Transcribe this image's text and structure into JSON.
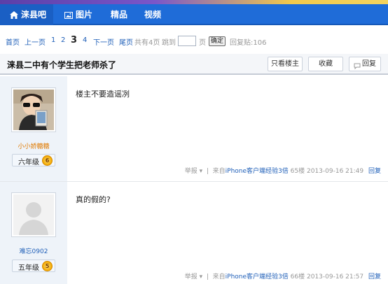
{
  "nav": {
    "items": [
      {
        "label": "涞县吧",
        "icon": "home-icon"
      },
      {
        "label": "图片",
        "icon": "image-icon"
      },
      {
        "label": "精品"
      },
      {
        "label": "视频"
      }
    ],
    "colors": {
      "bar": "#1f6cd8",
      "text": "#ffffff"
    }
  },
  "pager": {
    "first": "首页",
    "prev": "上一页",
    "pages": [
      "1",
      "2",
      "3",
      "4"
    ],
    "current": "3",
    "next": "下一页",
    "last": "尾页",
    "total_prefix": "共有",
    "total_count": "4",
    "total_suffix": "页",
    "jump_label": "跳到",
    "jump_suffix": "页",
    "confirm": "确定",
    "reply_label": "回复贴:",
    "reply_count": "106"
  },
  "thread": {
    "title": "涞县二中有个学生把老师杀了",
    "only_op": "只看楼主",
    "favorite": "收藏",
    "reply": "回复"
  },
  "posts": [
    {
      "username": "小小娇糖糖",
      "level": "六年级",
      "level_num": "6",
      "content": "楼主不要造谣冽",
      "report": "举报",
      "source_prefix": "来自",
      "source": "iPhone客户端",
      "exp": "经验3倍",
      "floor": "65楼",
      "time": "2013-09-16 21:49",
      "reply": "回复"
    },
    {
      "username": "难忘0902",
      "level": "五年级",
      "level_num": "5",
      "content": "真的假的?",
      "report": "举报",
      "source_prefix": "来自",
      "source": "iPhone客户端",
      "exp": "经验3倍",
      "floor": "66楼",
      "time": "2013-09-16 21:57",
      "reply": "回复"
    }
  ]
}
